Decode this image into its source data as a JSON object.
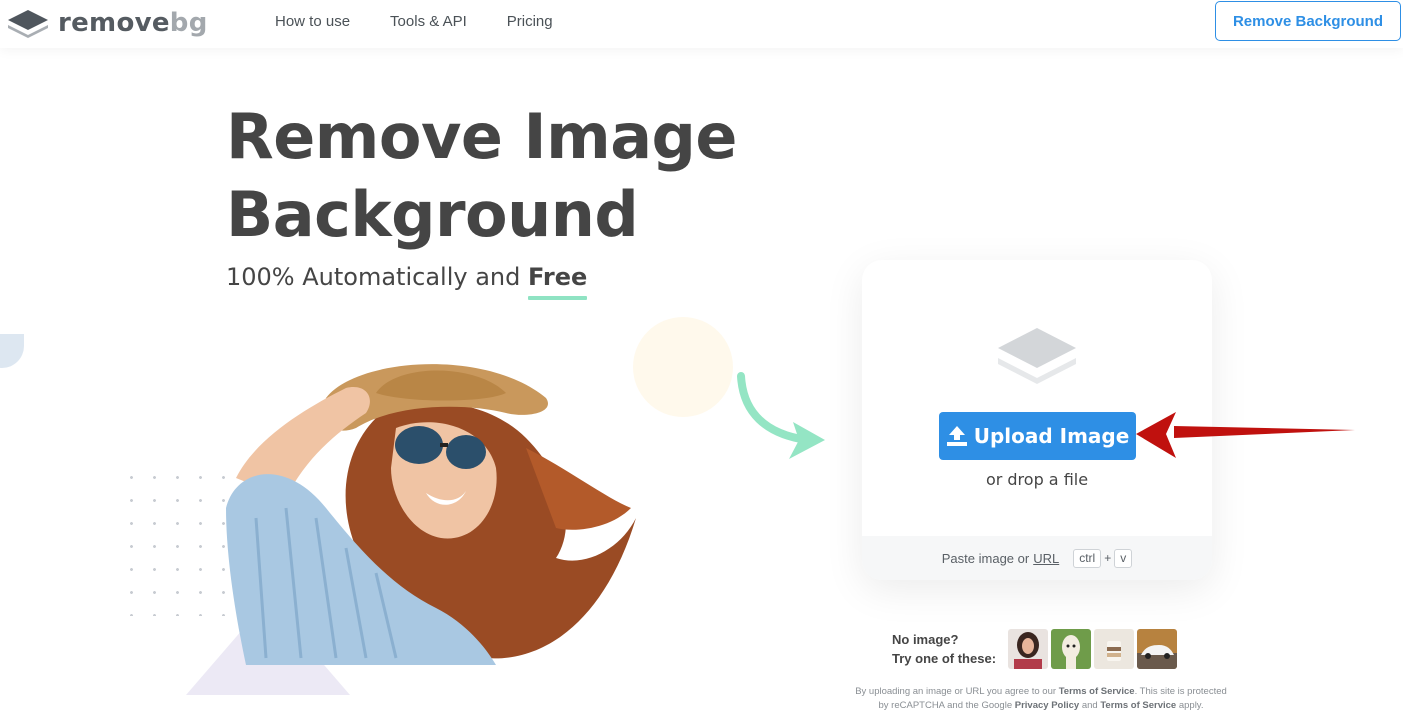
{
  "header": {
    "logo": {
      "text_main": "remove",
      "text_accent": "bg",
      "icon": "stacked-layers-icon"
    },
    "nav": [
      "How to use",
      "Tools & API",
      "Pricing"
    ],
    "cta_label": "Remove Background"
  },
  "hero": {
    "title_line1": "Remove Image",
    "title_line2": "Background",
    "subtitle_prefix": "100% Automatically and",
    "subtitle_highlight": "Free"
  },
  "upload": {
    "icon": "stacked-layers-icon",
    "button_label": "Upload Image",
    "button_icon": "upload-icon",
    "drop_text": "or drop a file",
    "paste_prefix": "Paste image or",
    "paste_url": "URL",
    "key_ctrl": "ctrl",
    "key_plus": "+",
    "key_v": "v"
  },
  "samples": {
    "label_line1": "No image?",
    "label_line2": "Try one of these:",
    "items": [
      "woman-sample",
      "alpaca-sample",
      "cup-sample",
      "car-sample"
    ]
  },
  "legal": {
    "part1": "By uploading an image or URL you agree to our",
    "tos1": "Terms of Service",
    "part2": ". This site is protected by reCAPTCHA and the Google",
    "privacy": "Privacy Policy",
    "part3": "and",
    "tos2": "Terms of Service",
    "part4": "apply."
  },
  "colors": {
    "accent": "#2e8fe5",
    "highlight_underline": "#8fe3c3",
    "annotation_arrow": "#c0110e",
    "text_dark": "#454545"
  }
}
